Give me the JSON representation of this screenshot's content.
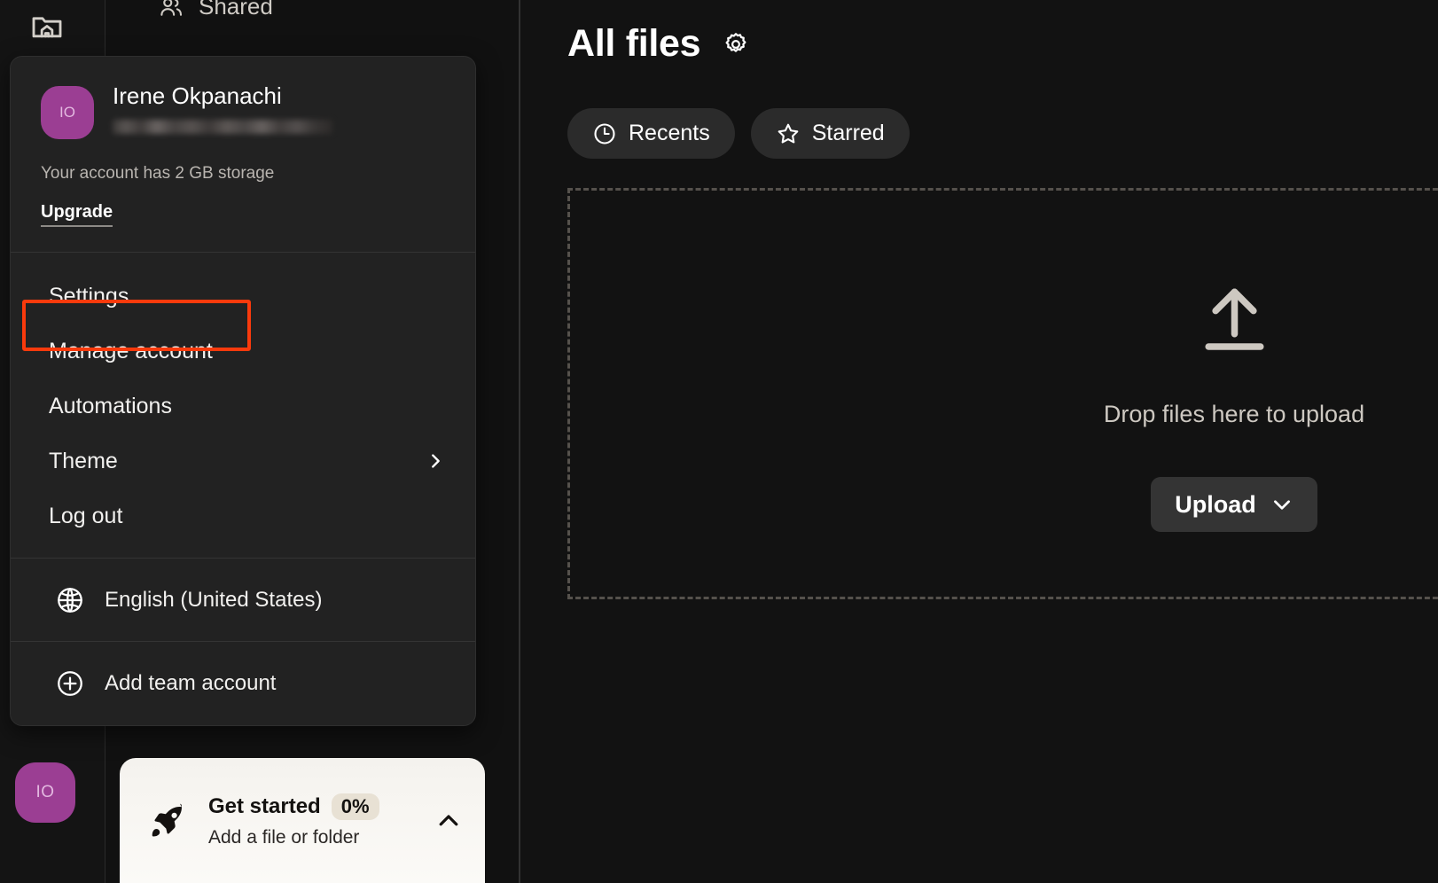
{
  "app": {
    "rail": {
      "home_icon": "folder-home-icon",
      "avatar_initials": "IO"
    },
    "shared_tab": {
      "label": "Shared",
      "icon": "people-icon"
    }
  },
  "account_menu": {
    "avatar_initials": "IO",
    "user_name": "Irene Okpanachi",
    "email_redacted": true,
    "storage_text": "Your account has 2 GB storage",
    "upgrade_label": "Upgrade",
    "items": [
      {
        "label": "Settings",
        "has_chevron": false,
        "highlighted": true
      },
      {
        "label": "Manage account",
        "has_chevron": false,
        "highlighted": false
      },
      {
        "label": "Automations",
        "has_chevron": false,
        "highlighted": false
      },
      {
        "label": "Theme",
        "has_chevron": true,
        "highlighted": false
      },
      {
        "label": "Log out",
        "has_chevron": false,
        "highlighted": false
      }
    ],
    "language_row": {
      "label": "English (United States)",
      "icon": "globe-icon"
    },
    "add_team_row": {
      "label": "Add team account",
      "icon": "plus-circle-icon"
    },
    "highlight_color": "#f93a0c"
  },
  "get_started": {
    "icon": "rocket-icon",
    "title": "Get started",
    "percent": "0%",
    "subtitle": "Add a file or folder",
    "collapse_icon": "chevron-up-icon"
  },
  "main": {
    "page_title": "All files",
    "settings_icon": "gear-icon",
    "pills": [
      {
        "label": "Recents",
        "icon": "clock-icon"
      },
      {
        "label": "Starred",
        "icon": "star-icon"
      }
    ],
    "dropzone": {
      "icon": "upload-arrow-icon",
      "text": "Drop files here to upload",
      "upload_button": "Upload",
      "upload_caret": "chevron-down-icon"
    }
  },
  "colors": {
    "background": "#121212",
    "rail": "#141414",
    "menu_panel": "#222222",
    "avatar_purple": "#9b3e93",
    "accent_highlight": "#f93a0c",
    "banner": "#f8f6f2"
  }
}
